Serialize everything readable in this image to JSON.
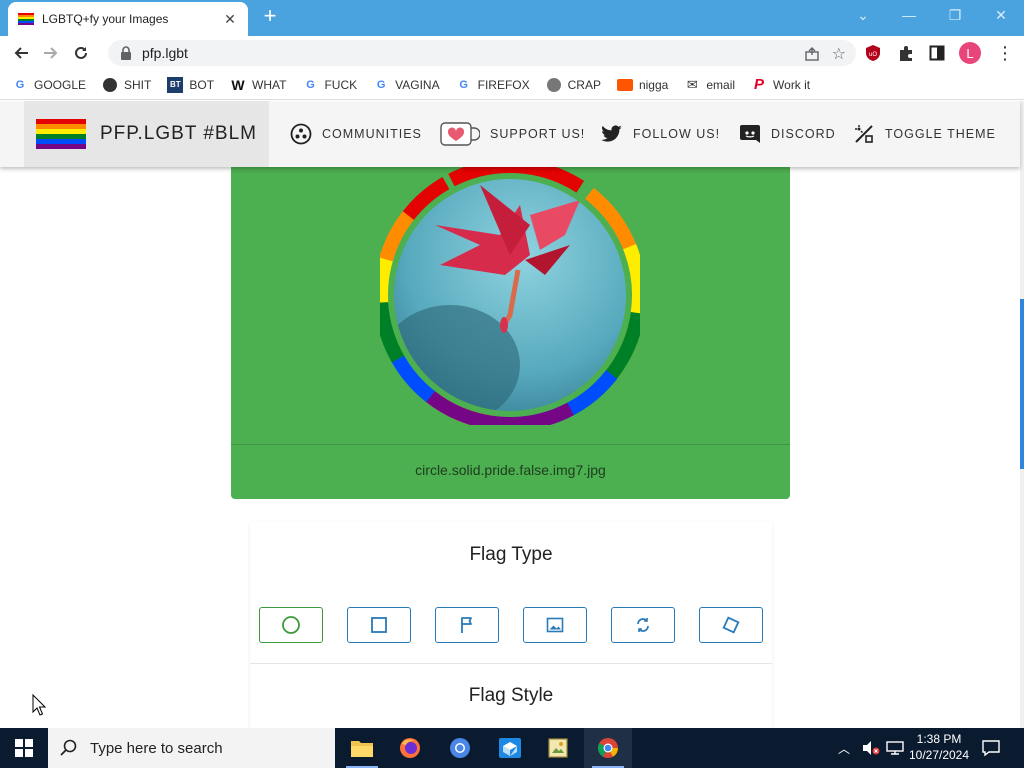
{
  "browser": {
    "tab_title": "LGBTQ+fy your Images",
    "url": "pfp.lgbt",
    "bookmarks": [
      {
        "label": "GOOGLE",
        "icon": "google-icon"
      },
      {
        "label": "SHIT",
        "icon": "site-icon"
      },
      {
        "label": "BOT",
        "icon": "bt-icon"
      },
      {
        "label": "WHAT",
        "icon": "w-icon"
      },
      {
        "label": "FUCK",
        "icon": "google-icon"
      },
      {
        "label": "VAGINA",
        "icon": "google-icon"
      },
      {
        "label": "FIREFOX",
        "icon": "google-icon"
      },
      {
        "label": "CRAP",
        "icon": "globe-icon"
      },
      {
        "label": "nigga",
        "icon": "soundcloud-icon"
      },
      {
        "label": "email",
        "icon": "mail-icon"
      },
      {
        "label": "Work it",
        "icon": "pinterest-icon"
      }
    ],
    "profile_initial": "L"
  },
  "site": {
    "brand": "PFP.LGBT #BLM",
    "nav": [
      {
        "label": "COMMUNITIES",
        "icon": "communities-icon"
      },
      {
        "label": "SUPPORT US!",
        "icon": "kofi-heart-icon"
      },
      {
        "label": "FOLLOW US!",
        "icon": "twitter-icon"
      },
      {
        "label": "DISCORD",
        "icon": "discord-icon"
      },
      {
        "label": "TOGGLE THEME",
        "icon": "theme-icon"
      }
    ],
    "preview": {
      "filename": "circle.solid.pride.false.img7.jpg"
    },
    "flag_type_heading": "Flag Type",
    "flag_style_heading": "Flag Style",
    "flag_type_options": [
      {
        "name": "circle",
        "icon": "circle-icon",
        "selected": true
      },
      {
        "name": "square",
        "icon": "square-icon",
        "selected": false
      },
      {
        "name": "flag",
        "icon": "flag-icon",
        "selected": false
      },
      {
        "name": "image",
        "icon": "image-icon",
        "selected": false
      },
      {
        "name": "rotate",
        "icon": "rotate-icon",
        "selected": false
      },
      {
        "name": "diamond",
        "icon": "diamond-icon",
        "selected": false
      }
    ]
  },
  "taskbar": {
    "search_placeholder": "Type here to search",
    "time": "1:38 PM",
    "date": "10/27/2024"
  },
  "colors": {
    "titlebar": "#4aa3df",
    "card_green": "#4caf50",
    "button_blue": "#2a7ab8",
    "button_green": "#3c9a3c",
    "pride": [
      "#e40303",
      "#ff8c00",
      "#ffed00",
      "#008026",
      "#004dff",
      "#750787"
    ]
  }
}
